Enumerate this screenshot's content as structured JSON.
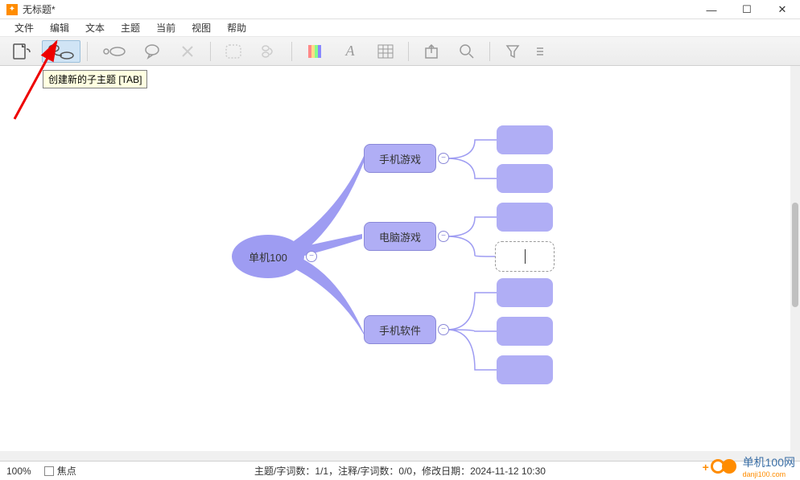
{
  "window": {
    "title": "无标题*"
  },
  "menu": {
    "items": [
      "文件",
      "编辑",
      "文本",
      "主题",
      "当前",
      "视图",
      "帮助"
    ]
  },
  "tooltip": {
    "new_child": "创建新的子主题 [TAB]"
  },
  "mindmap": {
    "root": "单机100",
    "subs": [
      "手机游戏",
      "电脑游戏",
      "手机软件"
    ]
  },
  "status": {
    "zoom": "100%",
    "focus_label": "焦点",
    "center": "主题/字词数：1/1，注释/字词数：0/0，修改日期：2024-11-12 10:30"
  },
  "watermark": {
    "name": "单机100网",
    "url": "danji100.com"
  }
}
